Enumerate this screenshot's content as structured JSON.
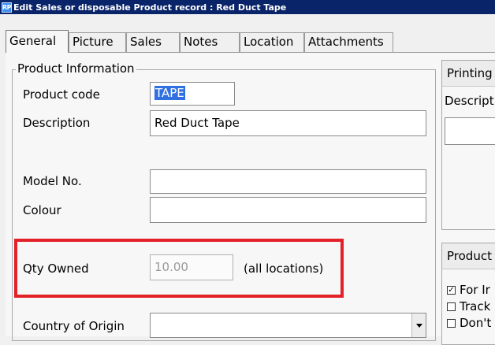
{
  "window": {
    "icon_text": "RP",
    "title": "Edit Sales or disposable Product record : Red Duct Tape"
  },
  "tabs": [
    {
      "label": "General"
    },
    {
      "label": "Picture"
    },
    {
      "label": "Sales"
    },
    {
      "label": "Notes"
    },
    {
      "label": "Location"
    },
    {
      "label": "Attachments"
    }
  ],
  "product_information": {
    "legend": "Product Information",
    "product_code": {
      "label": "Product code",
      "value": "TAPE"
    },
    "description": {
      "label": "Description",
      "value": "Red Duct Tape"
    },
    "model_no": {
      "label": "Model No.",
      "value": ""
    },
    "colour": {
      "label": "Colour",
      "value": ""
    },
    "qty_owned": {
      "label": "Qty Owned",
      "value": "10.00",
      "suffix": "(all locations)"
    },
    "country_of_origin": {
      "label": "Country of Origin",
      "value": ""
    }
  },
  "printing_panel": {
    "header": "Printing",
    "description_label": "Descript"
  },
  "product_panel": {
    "header": "Product",
    "checkboxes": [
      {
        "label": "For Ir",
        "checked": true
      },
      {
        "label": "Track",
        "checked": false
      },
      {
        "label": "Don't",
        "checked": false
      }
    ]
  },
  "colors": {
    "highlight": "#e32129",
    "titlebar": "#0a246a",
    "selection": "#3170e0"
  }
}
